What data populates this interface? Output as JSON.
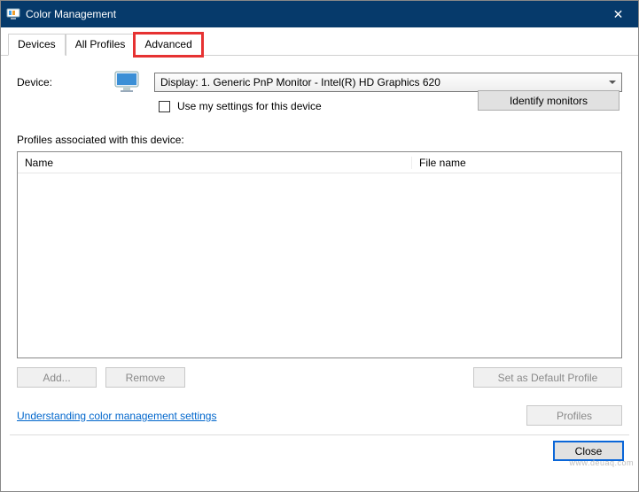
{
  "titlebar": {
    "title": "Color Management"
  },
  "tabs": {
    "devices": "Devices",
    "all_profiles": "All Profiles",
    "advanced": "Advanced"
  },
  "device": {
    "label": "Device:",
    "selected": "Display: 1. Generic PnP Monitor - Intel(R) HD Graphics 620",
    "use_my_settings": "Use my settings for this device",
    "identify": "Identify monitors"
  },
  "profiles": {
    "section_label": "Profiles associated with this device:",
    "col_name": "Name",
    "col_file": "File name"
  },
  "buttons": {
    "add": "Add...",
    "remove": "Remove",
    "set_default": "Set as Default Profile",
    "profiles": "Profiles",
    "close": "Close"
  },
  "link": {
    "text": "Understanding color management settings"
  },
  "watermark": "www.deuaq.com"
}
